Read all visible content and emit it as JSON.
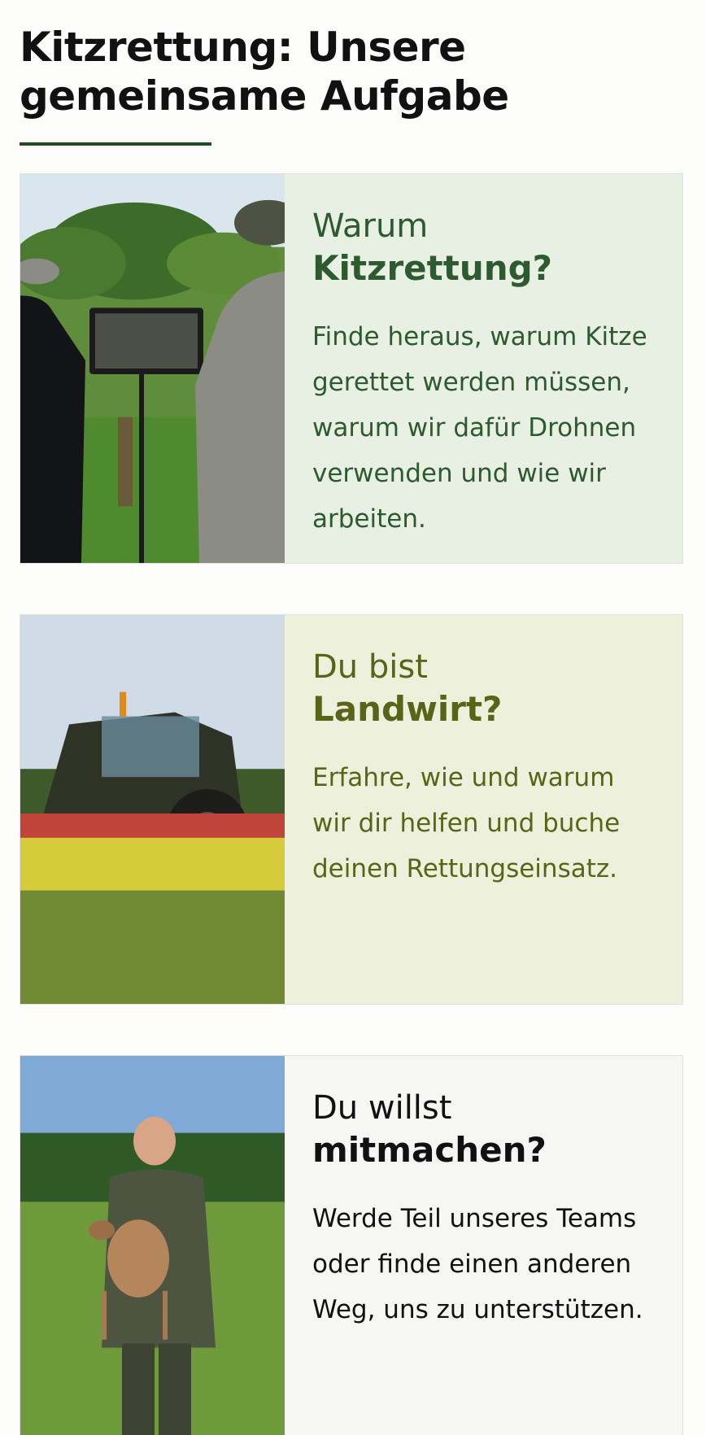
{
  "heading": "Kitzrettung: Unsere gemeinsame Aufgabe",
  "colors": {
    "underline": "#1e4d23",
    "card1_bg": "#e8efe3",
    "card1_text": "#2d5a2e",
    "card2_bg": "#edf0db",
    "card2_text": "#5a6419",
    "card3_bg": "#f6f6f5",
    "card3_text": "#111111"
  },
  "cards": [
    {
      "title_light": "Warum",
      "title_bold": "Kitzrettung?",
      "description": "Finde heraus, warum Kitze gerettet werden müssen, warum wir dafür Drohnen verwenden und wie wir arbeiten."
    },
    {
      "title_light": "Du bist",
      "title_bold": "Landwirt?",
      "description": "Erfahre, wie und warum wir dir helfen und buche deinen Rettungseinsatz."
    },
    {
      "title_light": "Du willst",
      "title_bold": "mitmachen?",
      "description": "Werde Teil unseres Teams oder finde einen anderen Weg, uns zu unterstützen."
    }
  ]
}
